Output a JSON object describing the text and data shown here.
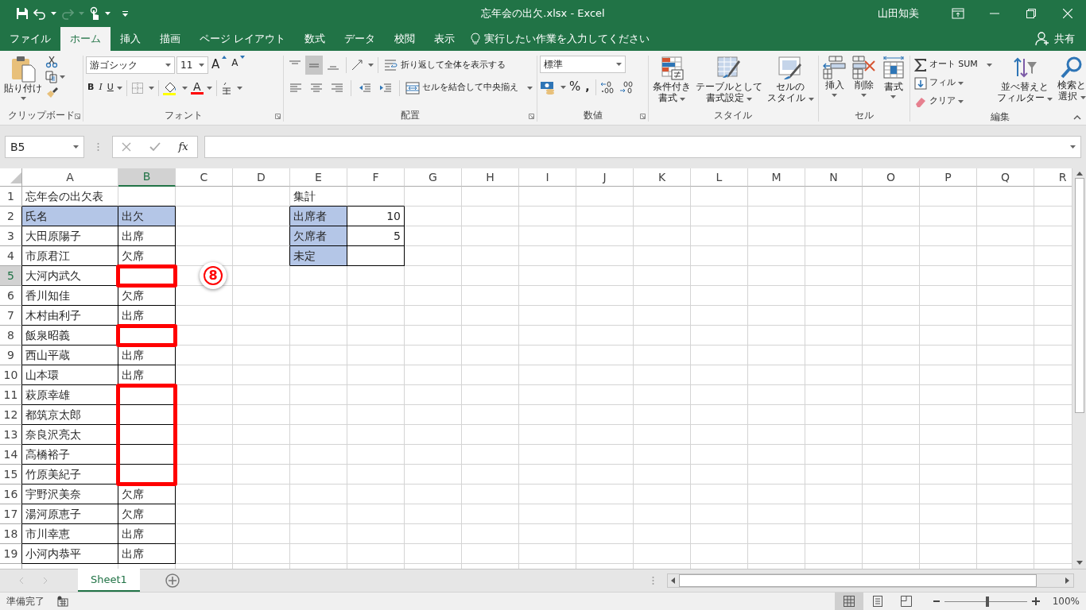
{
  "window": {
    "title": "忘年会の出欠.xlsx  -  Excel",
    "user": "山田知美"
  },
  "tabs": [
    {
      "label": "ファイル",
      "selected": false
    },
    {
      "label": "ホーム",
      "selected": true
    },
    {
      "label": "挿入",
      "selected": false
    },
    {
      "label": "描画",
      "selected": false
    },
    {
      "label": "ページ レイアウト",
      "selected": false
    },
    {
      "label": "数式",
      "selected": false
    },
    {
      "label": "データ",
      "selected": false
    },
    {
      "label": "校閲",
      "selected": false
    },
    {
      "label": "表示",
      "selected": false
    }
  ],
  "tell_me": {
    "placeholder": "実行したい作業を入力してください"
  },
  "share": "共有",
  "clipboard": {
    "paste": "貼り付け",
    "group": "クリップボード"
  },
  "font": {
    "name": "游ゴシック",
    "size": "11",
    "grow": "A",
    "shrink": "A",
    "bold": "B",
    "italic": "I",
    "underline": "U",
    "tint": "A",
    "group": "フォント"
  },
  "alignment": {
    "vertical": [
      {
        "selected": false
      },
      {
        "selected": true
      },
      {
        "selected": false
      }
    ],
    "wrap": "折り返して全体を表示する",
    "merge": "セルを結合して中央揃え",
    "group": "配置"
  },
  "number": {
    "format": "標準",
    "percent": "%",
    "comma": ",",
    "group": "数値"
  },
  "styles": {
    "conditional": [
      "条件付き",
      "書式"
    ],
    "table": [
      "テーブルとして",
      "書式設定"
    ],
    "cell_styles": [
      "セルの",
      "スタイル"
    ],
    "group": "スタイル"
  },
  "cells": {
    "insert": "挿入",
    "delete": "削除",
    "format": "書式",
    "group": "セル"
  },
  "editing": {
    "autosum": "オート SUM",
    "fill": "フィル",
    "clear": "クリア",
    "sort": [
      "並べ替えと",
      "フィルター"
    ],
    "find": [
      "検索と",
      "選択"
    ],
    "group": "編集"
  },
  "formula_bar": {
    "name_box": "B5",
    "function_label": "fx"
  },
  "columns": [
    {
      "label": "A",
      "selected": false
    },
    {
      "label": "B",
      "selected": true
    },
    {
      "label": "C",
      "selected": false
    },
    {
      "label": "D",
      "selected": false
    },
    {
      "label": "E",
      "selected": false
    },
    {
      "label": "F",
      "selected": false
    },
    {
      "label": "G",
      "selected": false
    },
    {
      "label": "H",
      "selected": false
    },
    {
      "label": "I",
      "selected": false
    },
    {
      "label": "J",
      "selected": false
    },
    {
      "label": "K",
      "selected": false
    },
    {
      "label": "L",
      "selected": false
    },
    {
      "label": "M",
      "selected": false
    },
    {
      "label": "N",
      "selected": false
    },
    {
      "label": "O",
      "selected": false
    },
    {
      "label": "P",
      "selected": false
    },
    {
      "label": "Q",
      "selected": false
    },
    {
      "label": "R",
      "selected": false
    }
  ],
  "rows": [
    {
      "number": "1",
      "selected": false,
      "cells": [
        {
          "text": "忘年会の出欠表",
          "kind": "title"
        },
        null,
        null,
        null,
        {
          "text": "集計",
          "kind": "title"
        }
      ]
    },
    {
      "number": "2",
      "selected": false,
      "cells": [
        {
          "text": "氏名",
          "kind": "header"
        },
        {
          "text": "出欠",
          "kind": "header"
        },
        null,
        null,
        {
          "text": "出席者",
          "kind": "header"
        },
        {
          "text": "10",
          "kind": "number"
        }
      ]
    },
    {
      "number": "3",
      "selected": false,
      "cells": [
        {
          "text": "大田原陽子",
          "kind": "data"
        },
        {
          "text": "出席",
          "kind": "data"
        },
        null,
        null,
        {
          "text": "欠席者",
          "kind": "header"
        },
        {
          "text": "5",
          "kind": "number"
        }
      ]
    },
    {
      "number": "4",
      "selected": false,
      "cells": [
        {
          "text": "市原君江",
          "kind": "data"
        },
        {
          "text": "欠席",
          "kind": "data"
        },
        null,
        null,
        {
          "text": "未定",
          "kind": "header"
        },
        {
          "kind": "number"
        }
      ]
    },
    {
      "number": "5",
      "selected": true,
      "callout": "8",
      "cells": [
        {
          "text": "大河内武久",
          "kind": "data"
        },
        {
          "kind": "data",
          "highlighted": true
        }
      ]
    },
    {
      "number": "6",
      "selected": false,
      "cells": [
        {
          "text": "香川知佳",
          "kind": "data"
        },
        {
          "text": "欠席",
          "kind": "data"
        }
      ]
    },
    {
      "number": "7",
      "selected": false,
      "cells": [
        {
          "text": "木村由利子",
          "kind": "data"
        },
        {
          "text": "出席",
          "kind": "data"
        }
      ]
    },
    {
      "number": "8",
      "selected": false,
      "cells": [
        {
          "text": "飯泉昭義",
          "kind": "data"
        },
        {
          "kind": "data",
          "highlighted": true
        }
      ]
    },
    {
      "number": "9",
      "selected": false,
      "cells": [
        {
          "text": "西山平蔵",
          "kind": "data"
        },
        {
          "text": "出席",
          "kind": "data"
        }
      ]
    },
    {
      "number": "10",
      "selected": false,
      "cells": [
        {
          "text": "山本環",
          "kind": "data"
        },
        {
          "text": "出席",
          "kind": "data"
        }
      ]
    },
    {
      "number": "11",
      "selected": false,
      "cells": [
        {
          "text": "萩原幸雄",
          "kind": "data"
        },
        {
          "kind": "data",
          "highlighted": true
        }
      ]
    },
    {
      "number": "12",
      "selected": false,
      "cells": [
        {
          "text": "都筑京太郎",
          "kind": "data"
        },
        {
          "kind": "data",
          "highlighted": true
        }
      ]
    },
    {
      "number": "13",
      "selected": false,
      "cells": [
        {
          "text": "奈良沢亮太",
          "kind": "data"
        },
        {
          "kind": "data",
          "highlighted": true
        }
      ]
    },
    {
      "number": "14",
      "selected": false,
      "cells": [
        {
          "text": "高橋裕子",
          "kind": "data"
        },
        {
          "kind": "data",
          "highlighted": true
        }
      ]
    },
    {
      "number": "15",
      "selected": false,
      "cells": [
        {
          "text": "竹原美紀子",
          "kind": "data"
        },
        {
          "kind": "data",
          "highlighted": true
        }
      ]
    },
    {
      "number": "16",
      "selected": false,
      "cells": [
        {
          "text": "宇野沢美奈",
          "kind": "data"
        },
        {
          "text": "欠席",
          "kind": "data"
        }
      ]
    },
    {
      "number": "17",
      "selected": false,
      "cells": [
        {
          "text": "湯河原恵子",
          "kind": "data"
        },
        {
          "text": "欠席",
          "kind": "data"
        }
      ]
    },
    {
      "number": "18",
      "selected": false,
      "cells": [
        {
          "text": "市川幸恵",
          "kind": "data"
        },
        {
          "text": "出席",
          "kind": "data"
        }
      ]
    },
    {
      "number": "19",
      "selected": false,
      "cells": [
        {
          "text": "小河内恭平",
          "kind": "data"
        },
        {
          "text": "出席",
          "kind": "data"
        }
      ]
    }
  ],
  "sheets": [
    {
      "label": "Sheet1",
      "selected": true
    }
  ],
  "status_bar": {
    "text": "準備完了",
    "views": [
      {
        "selected": true
      },
      {
        "selected": false
      },
      {
        "selected": false
      }
    ],
    "zoom": {
      "level": 0.5,
      "reading": "100%"
    }
  }
}
